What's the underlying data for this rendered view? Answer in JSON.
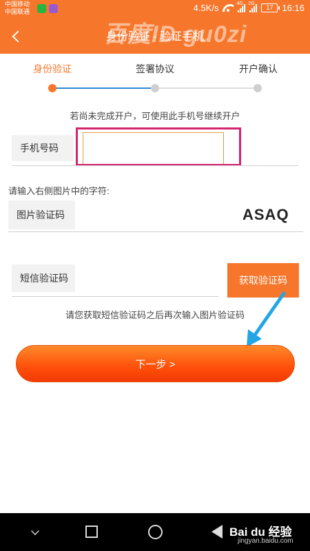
{
  "status_bar": {
    "carrier_1": "中国移动",
    "carrier_2": "中国联通",
    "speed": "4.5K/s",
    "net_4g": "4G",
    "net_2g": "2G",
    "battery": "17",
    "time": "16:16",
    "app_icon_1_color": "#29b33f",
    "app_icon_2_color": "#9b59d0"
  },
  "header": {
    "title": "身份验证 - 验证手机",
    "background_color": "#f6772c",
    "watermark": "百度ID gu0zi"
  },
  "steps": [
    {
      "label": "身份验证",
      "active": true
    },
    {
      "label": "签署协议",
      "active": false
    },
    {
      "label": "开户确认",
      "active": false
    }
  ],
  "form": {
    "phone_hint": "若尚未完成开户，可使用此手机号继续开户",
    "phone_label": "手机号码",
    "phone_value": "",
    "captcha_caption": "请输入右侧图片中的字符:",
    "captcha_label": "图片验证码",
    "captcha_text": "ASAQ",
    "sms_label": "短信验证码",
    "sms_button": "获取验证码",
    "sms_hint": "请您获取短信验证码之后再次输入图片验证码",
    "next_button": "下一步 >"
  },
  "nav_bar": {
    "brand": "Bai du 经验",
    "url": "jingyan.baidu.com"
  }
}
